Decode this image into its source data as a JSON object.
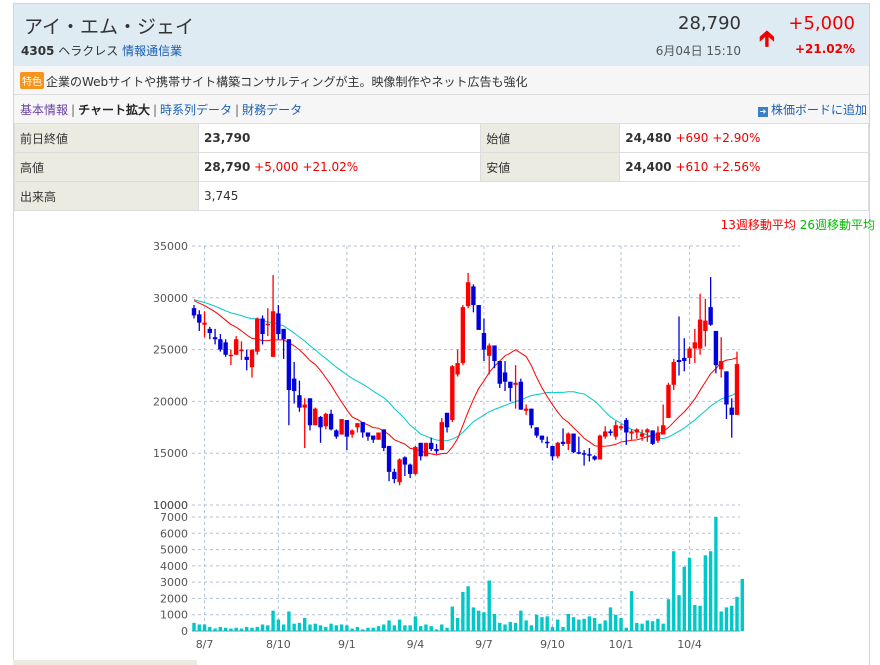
{
  "header": {
    "name": "アイ・エム・ジェイ",
    "code": "4305",
    "market": "ヘラクレス",
    "sector": "情報通信業",
    "price": "28,790",
    "date": "6月04日 15:10",
    "change": "+5,000",
    "change_pct": "+21.02%",
    "arrow_icon": "arrow-up"
  },
  "feature": {
    "badge": "特色",
    "text": "企業のWebサイトや携帯サイト構築コンサルティングが主。映像制作やネット広告も強化"
  },
  "nav": {
    "links": [
      "基本情報",
      "チャート拡大",
      "時系列データ",
      "財務データ"
    ],
    "add_board": "株価ボードに追加"
  },
  "quote": {
    "prev_close": {
      "label": "前日終値",
      "value": "23,790"
    },
    "open": {
      "label": "始値",
      "value": "24,480",
      "change": "+690",
      "pct": "+2.90%"
    },
    "high": {
      "label": "高値",
      "value": "28,790",
      "change": "+5,000",
      "pct": "+21.02%"
    },
    "low": {
      "label": "安値",
      "value": "24,400",
      "change": "+610",
      "pct": "+2.56%"
    },
    "volume": {
      "label": "出来高",
      "value": "3,745"
    }
  },
  "colors": {
    "up": "#ff0000",
    "down": "#0000dd",
    "ma13": "#ff0000",
    "ma26": "#00c8c8",
    "volume": "#00c8c8"
  },
  "chart_data": {
    "type": "candlestick",
    "legend": [
      "13週移動平均",
      "26週移動平均"
    ],
    "price_ticks": [
      35000,
      30000,
      25000,
      20000,
      15000,
      10000
    ],
    "price_ylim": [
      10000,
      35000
    ],
    "volume_ticks": [
      0,
      1000,
      2000,
      3000,
      4000,
      5000,
      6000,
      7000
    ],
    "volume_top_label": "10000",
    "volume_ylim": [
      0,
      7000
    ],
    "x_labels": [
      "8/7",
      "8/10",
      "9/1",
      "9/4",
      "9/7",
      "9/10",
      "10/1",
      "10/4"
    ],
    "x_label_index": [
      2,
      16,
      29,
      42,
      55,
      68,
      81,
      94
    ],
    "ohlc_thousands": [
      [
        29.0,
        29.3,
        28.0,
        28.3
      ],
      [
        28.4,
        28.8,
        26.8,
        27.6
      ],
      [
        27.4,
        28.7,
        26.2,
        27.6
      ],
      [
        27.0,
        27.2,
        26.0,
        26.6
      ],
      [
        26.2,
        27.0,
        25.5,
        26.0
      ],
      [
        26.0,
        26.5,
        24.8,
        25.0
      ],
      [
        25.7,
        26.0,
        24.3,
        24.5
      ],
      [
        24.5,
        25.0,
        23.5,
        24.5
      ],
      [
        24.5,
        26.3,
        24.5,
        26.0
      ],
      [
        25.0,
        25.8,
        24.0,
        25.0
      ],
      [
        24.3,
        25.0,
        23.0,
        24.0
      ],
      [
        23.3,
        25.0,
        22.3,
        25.0
      ],
      [
        24.8,
        28.1,
        24.5,
        28.0
      ],
      [
        28.0,
        28.3,
        25.5,
        26.5
      ],
      [
        27.5,
        29.0,
        26.3,
        27.5
      ],
      [
        24.3,
        32.2,
        24.3,
        28.7
      ],
      [
        28.5,
        29.3,
        26.0,
        26.5
      ],
      [
        27.0,
        27.0,
        24.1,
        26.0
      ],
      [
        26.0,
        26.0,
        17.7,
        21.1
      ],
      [
        22.2,
        23.8,
        19.8,
        21.0
      ],
      [
        20.6,
        22.0,
        19.0,
        19.4
      ],
      [
        19.4,
        20.3,
        15.5,
        19.7
      ],
      [
        20.3,
        20.3,
        17.2,
        17.7
      ],
      [
        17.7,
        19.4,
        17.7,
        19.3
      ],
      [
        18.5,
        18.6,
        16.0,
        17.5
      ],
      [
        17.6,
        18.9,
        17.3,
        18.8
      ],
      [
        18.8,
        19.2,
        17.2,
        17.3
      ],
      [
        17.2,
        17.3,
        16.4,
        16.6
      ],
      [
        16.8,
        18.3,
        16.8,
        18.3
      ],
      [
        18.2,
        18.2,
        15.3,
        16.6
      ],
      [
        16.8,
        17.3,
        16.5,
        17.2
      ],
      [
        17.5,
        17.9,
        17.0,
        17.9
      ],
      [
        18.0,
        18.0,
        16.5,
        17.0
      ],
      [
        17.0,
        17.0,
        16.2,
        16.6
      ],
      [
        16.7,
        16.7,
        16.0,
        16.3
      ],
      [
        16.3,
        17.0,
        16.3,
        17.0
      ],
      [
        17.3,
        17.3,
        15.2,
        15.5
      ],
      [
        15.7,
        15.7,
        12.3,
        13.2
      ],
      [
        13.2,
        13.5,
        12.1,
        12.5
      ],
      [
        12.2,
        14.5,
        11.9,
        14.4
      ],
      [
        14.6,
        14.7,
        12.8,
        13.9
      ],
      [
        13.9,
        14.0,
        12.6,
        13.0
      ],
      [
        13.0,
        15.7,
        12.9,
        15.6
      ],
      [
        16.0,
        16.0,
        14.3,
        14.7
      ],
      [
        14.7,
        16.0,
        14.7,
        16.0
      ],
      [
        16.0,
        16.5,
        15.2,
        15.4
      ],
      [
        15.4,
        15.9,
        14.9,
        15.2
      ],
      [
        15.3,
        18.4,
        15.3,
        18.0
      ],
      [
        18.9,
        18.9,
        17.0,
        17.5
      ],
      [
        18.2,
        23.5,
        18.0,
        23.4
      ],
      [
        22.6,
        25.0,
        22.4,
        23.7
      ],
      [
        23.7,
        29.3,
        23.5,
        29.1
      ],
      [
        29.2,
        32.4,
        29.0,
        31.5
      ],
      [
        31.1,
        31.3,
        28.6,
        29.3
      ],
      [
        29.3,
        29.3,
        26.9,
        26.9
      ],
      [
        26.6,
        28.0,
        23.9,
        25.0
      ],
      [
        24.4,
        25.6,
        22.6,
        25.4
      ],
      [
        25.4,
        25.4,
        23.2,
        23.9
      ],
      [
        23.9,
        23.9,
        21.3,
        21.7
      ],
      [
        22.8,
        23.9,
        21.0,
        21.9
      ],
      [
        21.9,
        21.9,
        20.0,
        21.3
      ],
      [
        21.6,
        23.5,
        19.3,
        21.8
      ],
      [
        21.9,
        22.2,
        19.2,
        19.2
      ],
      [
        19.1,
        19.7,
        18.7,
        19.3
      ],
      [
        19.3,
        19.3,
        17.4,
        17.7
      ],
      [
        17.5,
        17.5,
        16.5,
        16.7
      ],
      [
        16.7,
        16.7,
        16.0,
        16.3
      ],
      [
        16.1,
        16.6,
        15.5,
        16.0
      ],
      [
        15.7,
        15.7,
        14.3,
        14.7
      ],
      [
        14.7,
        16.1,
        14.5,
        16.0
      ],
      [
        16.1,
        17.4,
        15.7,
        15.9
      ],
      [
        15.9,
        17.0,
        15.3,
        16.9
      ],
      [
        16.9,
        16.9,
        15.0,
        15.1
      ],
      [
        15.1,
        16.6,
        14.9,
        15.0
      ],
      [
        15.0,
        15.3,
        13.8,
        14.9
      ],
      [
        14.9,
        15.5,
        14.2,
        14.8
      ],
      [
        14.7,
        14.8,
        14.3,
        14.4
      ],
      [
        14.4,
        16.8,
        14.4,
        16.7
      ],
      [
        16.6,
        17.6,
        16.4,
        17.1
      ],
      [
        17.1,
        17.3,
        16.7,
        17.0
      ],
      [
        16.6,
        18.1,
        16.3,
        17.7
      ],
      [
        17.4,
        17.8,
        17.2,
        17.6
      ],
      [
        18.2,
        18.4,
        15.8,
        17.0
      ],
      [
        16.9,
        17.3,
        16.3,
        17.1
      ],
      [
        17.0,
        17.4,
        16.4,
        17.3
      ],
      [
        16.6,
        17.3,
        16.2,
        16.9
      ],
      [
        17.0,
        17.4,
        16.1,
        17.3
      ],
      [
        17.2,
        17.2,
        15.8,
        15.9
      ],
      [
        16.2,
        17.6,
        16.0,
        17.0
      ],
      [
        16.8,
        19.7,
        16.8,
        17.7
      ],
      [
        18.4,
        21.8,
        18.4,
        21.6
      ],
      [
        21.6,
        24.1,
        21.1,
        23.8
      ],
      [
        24.0,
        28.2,
        22.5,
        23.8
      ],
      [
        24.2,
        26.1,
        22.9,
        23.9
      ],
      [
        24.2,
        25.3,
        23.6,
        25.1
      ],
      [
        25.1,
        27.0,
        23.7,
        25.7
      ],
      [
        25.1,
        30.4,
        24.5,
        27.9
      ],
      [
        26.8,
        29.9,
        25.3,
        27.8
      ],
      [
        29.1,
        32.0,
        27.3,
        27.4
      ],
      [
        26.8,
        26.8,
        22.7,
        23.5
      ],
      [
        23.1,
        26.2,
        22.3,
        23.9
      ],
      [
        22.9,
        22.9,
        18.3,
        19.7
      ],
      [
        19.4,
        20.3,
        16.5,
        18.7
      ],
      [
        18.7,
        24.8,
        18.7,
        23.6
      ]
    ],
    "volume": [
      500,
      400,
      400,
      250,
      150,
      250,
      200,
      150,
      200,
      150,
      250,
      200,
      250,
      400,
      350,
      1250,
      700,
      400,
      1200,
      450,
      500,
      800,
      400,
      450,
      350,
      250,
      450,
      350,
      400,
      350,
      150,
      250,
      100,
      200,
      200,
      300,
      400,
      650,
      350,
      700,
      350,
      350,
      900,
      300,
      400,
      300,
      100,
      400,
      200,
      1500,
      800,
      2400,
      2750,
      1450,
      1250,
      1150,
      3100,
      1050,
      500,
      400,
      550,
      500,
      1250,
      650,
      350,
      1000,
      850,
      900,
      250,
      700,
      250,
      1050,
      850,
      700,
      750,
      900,
      800,
      450,
      650,
      1450,
      1000,
      800,
      200,
      2450,
      500,
      450,
      650,
      600,
      750,
      450,
      1950,
      4900,
      2200,
      3950,
      4500,
      1600,
      1550,
      4650,
      4900,
      7000,
      1200,
      1450,
      1550,
      2100,
      3200
    ]
  }
}
